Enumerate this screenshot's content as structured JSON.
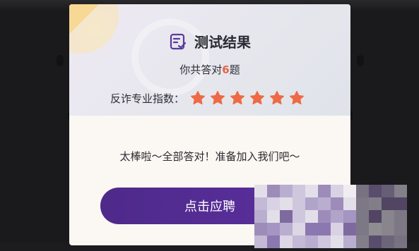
{
  "dialog": {
    "title": "测试结果",
    "subtitle_prefix": "你共答对",
    "correct_count": "6",
    "subtitle_suffix": "题",
    "rating_label": "反诈专业指数：",
    "rating_stars": 6,
    "message": "太棒啦～全部答对！准备加入我们吧～",
    "apply_button": "点击应聘"
  },
  "colors": {
    "accent_purple": "#4e2a8a",
    "star_orange": "#ee6a44",
    "count_red": "#e8634a"
  },
  "icons": {
    "title_icon": "result-document-icon",
    "star_icon": "star-icon"
  }
}
